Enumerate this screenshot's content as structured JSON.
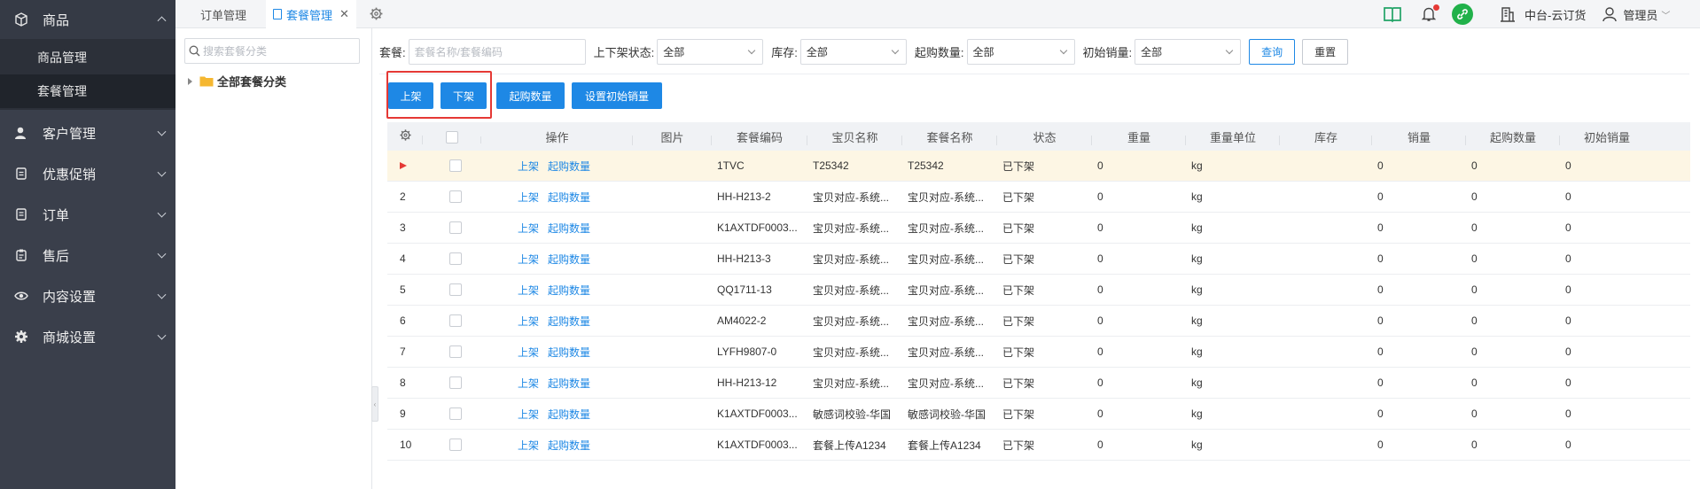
{
  "sidebar": {
    "groups": [
      {
        "label": "商品",
        "icon": "box-icon",
        "expanded": true,
        "items": [
          {
            "label": "商品管理"
          },
          {
            "label": "套餐管理",
            "active": true
          }
        ]
      },
      {
        "label": "客户管理",
        "icon": "user-icon"
      },
      {
        "label": "优惠促销",
        "icon": "coupon-icon"
      },
      {
        "label": "订单",
        "icon": "order-icon"
      },
      {
        "label": "售后",
        "icon": "clipboard-icon"
      },
      {
        "label": "内容设置",
        "icon": "eye-icon"
      },
      {
        "label": "商城设置",
        "icon": "gear-icon"
      }
    ]
  },
  "tabs": [
    {
      "label": "订单管理",
      "active": false
    },
    {
      "label": "套餐管理",
      "active": true
    }
  ],
  "header": {
    "store": "中台-云订货",
    "user": "管理员"
  },
  "category": {
    "search_placeholder": "搜索套餐分类",
    "root": "全部套餐分类"
  },
  "filters": {
    "package_label": "套餐:",
    "package_placeholder": "套餐名称/套餐编码",
    "status_label": "上下架状态:",
    "status_value": "全部",
    "stock_label": "库存:",
    "stock_value": "全部",
    "minqty_label": "起购数量:",
    "minqty_value": "全部",
    "initsales_label": "初始销量:",
    "initsales_value": "全部",
    "query_btn": "查询",
    "reset_btn": "重置"
  },
  "actions": {
    "list_on": "上架",
    "list_off": "下架",
    "min_qty": "起购数量",
    "init_sales": "设置初始销量"
  },
  "table": {
    "headers": [
      "操作",
      "图片",
      "套餐编码",
      "宝贝名称",
      "套餐名称",
      "状态",
      "重量",
      "重量单位",
      "库存",
      "销量",
      "起购数量",
      "初始销量"
    ],
    "op_links": [
      "上架",
      "起购数量"
    ],
    "rows": [
      {
        "idx": "",
        "code": "1TVC",
        "item": "T25342",
        "name": "T25342",
        "status": "已下架",
        "weight": "0",
        "unit": "kg",
        "stock": "",
        "sales": "0",
        "minqty": "0",
        "init": "0",
        "selected": true
      },
      {
        "idx": "2",
        "code": "HH-H213-2",
        "item": "宝贝对应-系统...",
        "name": "宝贝对应-系统...",
        "status": "已下架",
        "weight": "0",
        "unit": "kg",
        "stock": "",
        "sales": "0",
        "minqty": "0",
        "init": "0"
      },
      {
        "idx": "3",
        "code": "K1AXTDF0003...",
        "item": "宝贝对应-系统...",
        "name": "宝贝对应-系统...",
        "status": "已下架",
        "weight": "0",
        "unit": "kg",
        "stock": "",
        "sales": "0",
        "minqty": "0",
        "init": "0"
      },
      {
        "idx": "4",
        "code": "HH-H213-3",
        "item": "宝贝对应-系统...",
        "name": "宝贝对应-系统...",
        "status": "已下架",
        "weight": "0",
        "unit": "kg",
        "stock": "",
        "sales": "0",
        "minqty": "0",
        "init": "0"
      },
      {
        "idx": "5",
        "code": "QQ1711-13",
        "item": "宝贝对应-系统...",
        "name": "宝贝对应-系统...",
        "status": "已下架",
        "weight": "0",
        "unit": "kg",
        "stock": "",
        "sales": "0",
        "minqty": "0",
        "init": "0"
      },
      {
        "idx": "6",
        "code": "AM4022-2",
        "item": "宝贝对应-系统...",
        "name": "宝贝对应-系统...",
        "status": "已下架",
        "weight": "0",
        "unit": "kg",
        "stock": "",
        "sales": "0",
        "minqty": "0",
        "init": "0"
      },
      {
        "idx": "7",
        "code": "LYFH9807-0",
        "item": "宝贝对应-系统...",
        "name": "宝贝对应-系统...",
        "status": "已下架",
        "weight": "0",
        "unit": "kg",
        "stock": "",
        "sales": "0",
        "minqty": "0",
        "init": "0"
      },
      {
        "idx": "8",
        "code": "HH-H213-12",
        "item": "宝贝对应-系统...",
        "name": "宝贝对应-系统...",
        "status": "已下架",
        "weight": "0",
        "unit": "kg",
        "stock": "",
        "sales": "0",
        "minqty": "0",
        "init": "0"
      },
      {
        "idx": "9",
        "code": "K1AXTDF0003...",
        "item": "敏感词校验-华国",
        "name": "敏感词校验-华国",
        "status": "已下架",
        "weight": "0",
        "unit": "kg",
        "stock": "",
        "sales": "0",
        "minqty": "0",
        "init": "0"
      },
      {
        "idx": "10",
        "code": "K1AXTDF0003...",
        "item": "套餐上传A1234",
        "name": "套餐上传A1234",
        "status": "已下架",
        "weight": "0",
        "unit": "kg",
        "stock": "",
        "sales": "0",
        "minqty": "0",
        "init": "0"
      }
    ]
  },
  "colors": {
    "primary": "#1e88e5",
    "sidebar": "#3a3f4b",
    "highlight": "#e53935",
    "selected_row": "#fdf6e4"
  }
}
